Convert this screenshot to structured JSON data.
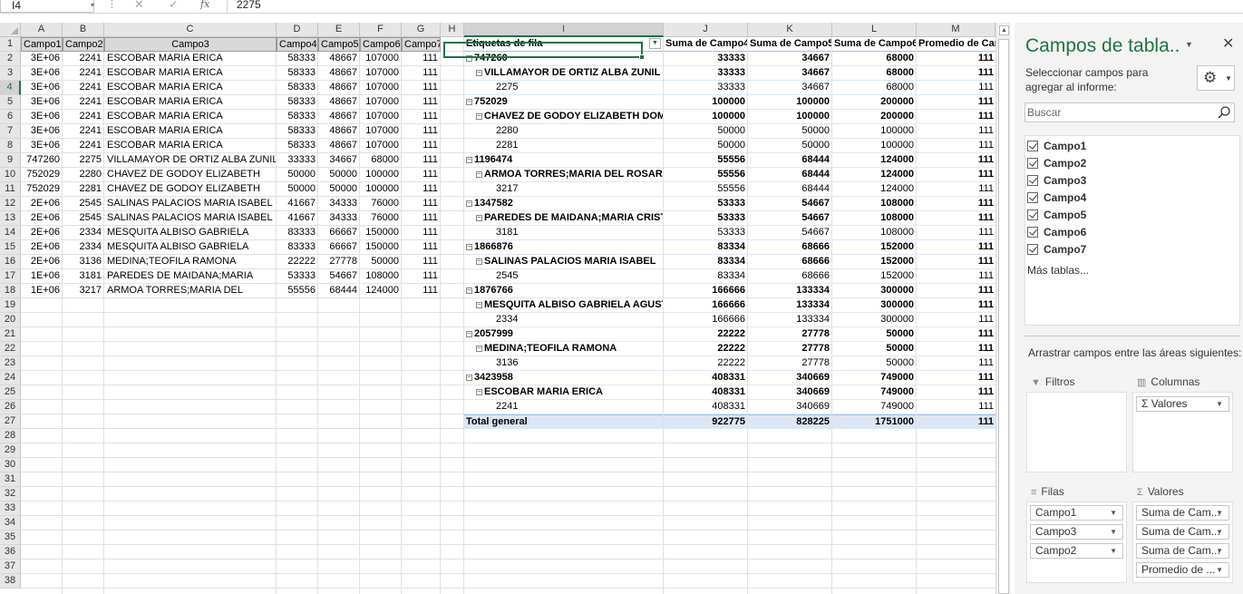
{
  "formula_bar": {
    "name_box": "I4",
    "cancel_icon": "✕",
    "enter_icon": "✓",
    "fx_label": "fx",
    "formula": "2275"
  },
  "columns": [
    "A",
    "B",
    "C",
    "D",
    "E",
    "F",
    "G",
    "H",
    "I",
    "J",
    "K",
    "L",
    "M"
  ],
  "row_numbers": [
    "1",
    "2",
    "3",
    "4",
    "5",
    "6",
    "7",
    "8",
    "9",
    "10",
    "11",
    "12",
    "13",
    "14",
    "15",
    "16",
    "17",
    "18",
    "19",
    "20",
    "21",
    "22",
    "23",
    "24",
    "25",
    "26",
    "27",
    "28",
    "29",
    "30",
    "31",
    "32",
    "33",
    "34",
    "35",
    "36",
    "37",
    "38"
  ],
  "source_table": {
    "headers": [
      "Campo1",
      "Campo2",
      "Campo3",
      "Campo4",
      "Campo5",
      "Campo6",
      "Campo7"
    ],
    "rows": [
      [
        "3E+06",
        "2241",
        "ESCOBAR MARIA ERICA",
        "58333",
        "48667",
        "107000",
        "111"
      ],
      [
        "3E+06",
        "2241",
        "ESCOBAR MARIA ERICA",
        "58333",
        "48667",
        "107000",
        "111"
      ],
      [
        "3E+06",
        "2241",
        "ESCOBAR MARIA ERICA",
        "58333",
        "48667",
        "107000",
        "111"
      ],
      [
        "3E+06",
        "2241",
        "ESCOBAR MARIA ERICA",
        "58333",
        "48667",
        "107000",
        "111"
      ],
      [
        "3E+06",
        "2241",
        "ESCOBAR MARIA ERICA",
        "58333",
        "48667",
        "107000",
        "111"
      ],
      [
        "3E+06",
        "2241",
        "ESCOBAR MARIA ERICA",
        "58333",
        "48667",
        "107000",
        "111"
      ],
      [
        "3E+06",
        "2241",
        "ESCOBAR MARIA ERICA",
        "58333",
        "48667",
        "107000",
        "111"
      ],
      [
        "747260",
        "2275",
        "VILLAMAYOR DE ORTIZ ALBA ZUNIL",
        "33333",
        "34667",
        "68000",
        "111"
      ],
      [
        "752029",
        "2280",
        "CHAVEZ DE GODOY ELIZABETH",
        "50000",
        "50000",
        "100000",
        "111"
      ],
      [
        "752029",
        "2281",
        "CHAVEZ DE GODOY ELIZABETH",
        "50000",
        "50000",
        "100000",
        "111"
      ],
      [
        "2E+06",
        "2545",
        "SALINAS PALACIOS MARIA ISABEL",
        "41667",
        "34333",
        "76000",
        "111"
      ],
      [
        "2E+06",
        "2545",
        "SALINAS PALACIOS MARIA ISABEL",
        "41667",
        "34333",
        "76000",
        "111"
      ],
      [
        "2E+06",
        "2334",
        "MESQUITA ALBISO GABRIELA",
        "83333",
        "66667",
        "150000",
        "111"
      ],
      [
        "2E+06",
        "2334",
        "MESQUITA ALBISO GABRIELA",
        "83333",
        "66667",
        "150000",
        "111"
      ],
      [
        "2E+06",
        "3136",
        "MEDINA;TEOFILA RAMONA",
        "22222",
        "27778",
        "50000",
        "111"
      ],
      [
        "1E+06",
        "3181",
        "PAREDES DE MAIDANA;MARIA",
        "53333",
        "54667",
        "108000",
        "111"
      ],
      [
        "1E+06",
        "3217",
        "ARMOA TORRES;MARIA DEL",
        "55556",
        "68444",
        "124000",
        "111"
      ]
    ]
  },
  "pivot": {
    "headers": [
      "Etiquetas de fila",
      "Suma de Campo4",
      "Suma de Campo5",
      "Suma de Campo6",
      "Promedio de Cam"
    ],
    "rows": [
      {
        "level": 0,
        "label": "747260",
        "v": [
          "33333",
          "34667",
          "68000",
          "111"
        ]
      },
      {
        "level": 1,
        "label": "VILLAMAYOR DE ORTIZ ALBA ZUNIL",
        "v": [
          "33333",
          "34667",
          "68000",
          "111"
        ]
      },
      {
        "level": 2,
        "label": "2275",
        "v": [
          "33333",
          "34667",
          "68000",
          "111"
        ]
      },
      {
        "level": 0,
        "label": "752029",
        "v": [
          "100000",
          "100000",
          "200000",
          "111"
        ]
      },
      {
        "level": 1,
        "label": "CHAVEZ DE GODOY ELIZABETH DOMI",
        "v": [
          "100000",
          "100000",
          "200000",
          "111"
        ]
      },
      {
        "level": 2,
        "label": "2280",
        "v": [
          "50000",
          "50000",
          "100000",
          "111"
        ]
      },
      {
        "level": 2,
        "label": "2281",
        "v": [
          "50000",
          "50000",
          "100000",
          "111"
        ]
      },
      {
        "level": 0,
        "label": "1196474",
        "v": [
          "55556",
          "68444",
          "124000",
          "111"
        ]
      },
      {
        "level": 1,
        "label": "ARMOA TORRES;MARIA DEL ROSARIO",
        "v": [
          "55556",
          "68444",
          "124000",
          "111"
        ]
      },
      {
        "level": 2,
        "label": "3217",
        "v": [
          "55556",
          "68444",
          "124000",
          "111"
        ]
      },
      {
        "level": 0,
        "label": "1347582",
        "v": [
          "53333",
          "54667",
          "108000",
          "111"
        ]
      },
      {
        "level": 1,
        "label": "PAREDES DE MAIDANA;MARIA CRIST",
        "v": [
          "53333",
          "54667",
          "108000",
          "111"
        ]
      },
      {
        "level": 2,
        "label": "3181",
        "v": [
          "53333",
          "54667",
          "108000",
          "111"
        ]
      },
      {
        "level": 0,
        "label": "1866876",
        "v": [
          "83334",
          "68666",
          "152000",
          "111"
        ]
      },
      {
        "level": 1,
        "label": "SALINAS PALACIOS MARIA ISABEL",
        "v": [
          "83334",
          "68666",
          "152000",
          "111"
        ]
      },
      {
        "level": 2,
        "label": "2545",
        "v": [
          "83334",
          "68666",
          "152000",
          "111"
        ]
      },
      {
        "level": 0,
        "label": "1876766",
        "v": [
          "166666",
          "133334",
          "300000",
          "111"
        ]
      },
      {
        "level": 1,
        "label": "MESQUITA ALBISO GABRIELA AGUST",
        "v": [
          "166666",
          "133334",
          "300000",
          "111"
        ]
      },
      {
        "level": 2,
        "label": "2334",
        "v": [
          "166666",
          "133334",
          "300000",
          "111"
        ]
      },
      {
        "level": 0,
        "label": "2057999",
        "v": [
          "22222",
          "27778",
          "50000",
          "111"
        ]
      },
      {
        "level": 1,
        "label": "MEDINA;TEOFILA RAMONA",
        "v": [
          "22222",
          "27778",
          "50000",
          "111"
        ]
      },
      {
        "level": 2,
        "label": "3136",
        "v": [
          "22222",
          "27778",
          "50000",
          "111"
        ]
      },
      {
        "level": 0,
        "label": "3423958",
        "v": [
          "408331",
          "340669",
          "749000",
          "111"
        ]
      },
      {
        "level": 1,
        "label": "ESCOBAR MARIA ERICA",
        "v": [
          "408331",
          "340669",
          "749000",
          "111"
        ]
      },
      {
        "level": 2,
        "label": "2241",
        "v": [
          "408331",
          "340669",
          "749000",
          "111"
        ]
      }
    ],
    "total": {
      "label": "Total general",
      "v": [
        "922775",
        "828225",
        "1751000",
        "111"
      ]
    }
  },
  "pane": {
    "title": "Campos de tabla..",
    "subtitle": "Seleccionar campos para agregar al informe:",
    "search_placeholder": "Buscar",
    "fields": [
      "Campo1",
      "Campo2",
      "Campo3",
      "Campo4",
      "Campo5",
      "Campo6",
      "Campo7"
    ],
    "more_tables": "Más tablas...",
    "areas_caption": "Arrastrar campos entre las áreas siguientes:",
    "filters_label": "Filtros",
    "columns_label": "Columnas",
    "rows_label": "Filas",
    "values_label": "Valores",
    "columns_chips": [
      "Σ Valores"
    ],
    "rows_chips": [
      "Campo1",
      "Campo3",
      "Campo2"
    ],
    "values_chips": [
      "Suma de Cam...",
      "Suma de Cam...",
      "Suma de Cam...",
      "Promedio de ..."
    ]
  },
  "colors": {
    "accent": "#217346",
    "pivot_header_line": "#9bc2e6",
    "pivot_total_bg": "#dde7f3"
  }
}
